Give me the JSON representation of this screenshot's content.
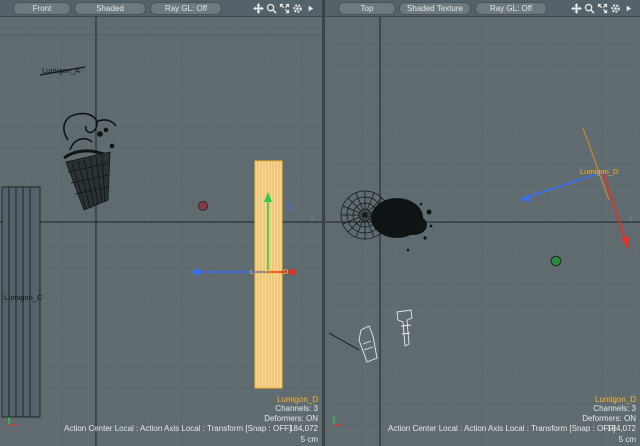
{
  "left_viewport": {
    "toolbar": {
      "view_mode": "Front",
      "shading": "Shaded",
      "raygl": "Ray GL: Off",
      "icons": [
        "move-view-icon",
        "zoom-view-icon",
        "maximize-viewport-icon",
        "viewport-options-icon",
        "viewport-menu-arrow-icon"
      ]
    },
    "labels": {
      "lumigon_a": "Lumigon_A",
      "lumigon_c": "Lumigon_C",
      "lumigon_d": "Lumigon_D"
    },
    "axis_right_label": "X"
  },
  "right_viewport": {
    "toolbar": {
      "view_mode": "Top",
      "shading": "Shaded Texture",
      "raygl": "Ray GL: Off",
      "icons": [
        "move-view-icon",
        "zoom-view-icon",
        "maximize-viewport-icon",
        "viewport-options-icon",
        "viewport-menu-arrow-icon"
      ]
    },
    "labels": {
      "lumigon_d": "Lumigon_D"
    },
    "axis_right_label": "X"
  },
  "hud": {
    "selected_name": "Lumigon_D",
    "channels": "Channels: 3",
    "deformers": "Deformers: ON",
    "status_line": "Action Center Local : Action Axis Local : Transform  [Snap : OFF]",
    "poly_count": "184,072",
    "grid_size": "5 cm"
  },
  "colors": {
    "viewport_bg": "#5f6b6f",
    "grid_line": "#6a777b",
    "axis_line": "#1a1f21",
    "selection_orange": "#ffb52e",
    "gizmo_x": "#e0332a",
    "gizmo_y": "#2ecc4a",
    "gizmo_z": "#3d6fe6"
  }
}
